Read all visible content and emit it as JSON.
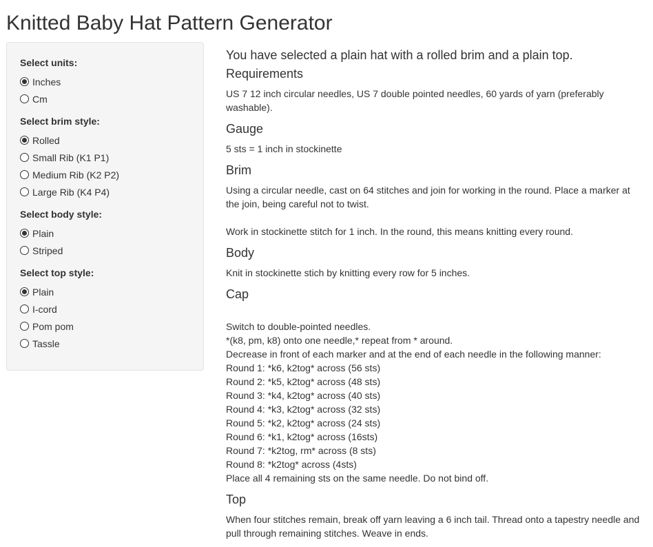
{
  "page": {
    "title": "Knitted Baby Hat Pattern Generator"
  },
  "sidebar": {
    "groups": [
      {
        "label": "Select units:",
        "options": [
          {
            "label": "Inches",
            "checked": true
          },
          {
            "label": "Cm",
            "checked": false
          }
        ]
      },
      {
        "label": "Select brim style:",
        "options": [
          {
            "label": "Rolled",
            "checked": true
          },
          {
            "label": "Small Rib (K1 P1)",
            "checked": false
          },
          {
            "label": "Medium Rib (K2 P2)",
            "checked": false
          },
          {
            "label": "Large Rib (K4 P4)",
            "checked": false
          }
        ]
      },
      {
        "label": "Select body style:",
        "options": [
          {
            "label": "Plain",
            "checked": true
          },
          {
            "label": "Striped",
            "checked": false
          }
        ]
      },
      {
        "label": "Select top style:",
        "options": [
          {
            "label": "Plain",
            "checked": true
          },
          {
            "label": "I-cord",
            "checked": false
          },
          {
            "label": "Pom pom",
            "checked": false
          },
          {
            "label": "Tassle",
            "checked": false
          }
        ]
      }
    ]
  },
  "main": {
    "summary": "You have selected a plain hat with a rolled brim and a plain top.",
    "requirements": {
      "heading": "Requirements",
      "text": "US 7 12 inch circular needles, US 7 double pointed needles, 60 yards of yarn (preferably washable)."
    },
    "gauge": {
      "heading": "Gauge",
      "text": "5 sts = 1 inch in stockinette"
    },
    "brim": {
      "heading": "Brim",
      "text1": "Using a circular needle, cast on 64 stitches and join for working in the round. Place a marker at the join, being careful not to twist.",
      "text2": "Work in stockinette stitch for 1 inch. In the round, this means knitting every round."
    },
    "body": {
      "heading": "Body",
      "text": "Knit in stockinette stich by knitting every row for 5 inches."
    },
    "cap": {
      "heading": "Cap",
      "lines": [
        "Switch to double-pointed needles.",
        "*(k8, pm, k8) onto one needle,* repeat from * around.",
        "Decrease in front of each marker and at the end of each needle in the following manner:",
        "Round 1: *k6, k2tog* across (56 sts)",
        "Round 2: *k5, k2tog* across (48 sts)",
        "Round 3: *k4, k2tog* across (40 sts)",
        "Round 4: *k3, k2tog* across (32 sts)",
        "Round 5: *k2, k2tog* across (24 sts)",
        "Round 6: *k1, k2tog* across (16sts)",
        "Round 7: *k2tog, rm* across (8 sts)",
        "Round 8: *k2tog* across (4sts)",
        "Place all 4 remaining sts on the same needle. Do not bind off."
      ]
    },
    "top": {
      "heading": "Top",
      "text": "When four stitches remain, break off yarn leaving a 6 inch tail. Thread onto a tapestry needle and pull through remaining stitches. Weave in ends."
    }
  }
}
